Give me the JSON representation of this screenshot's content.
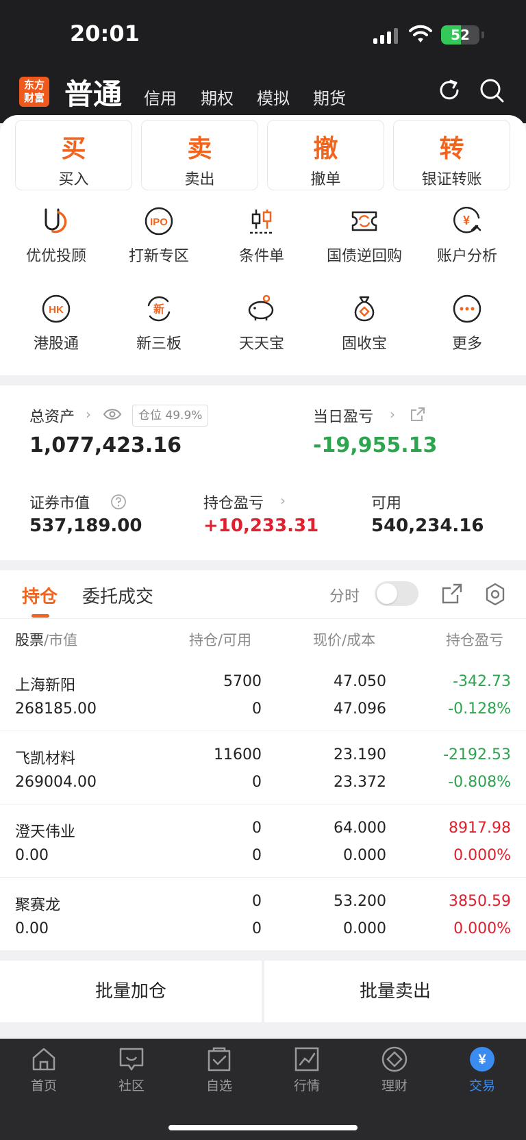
{
  "status": {
    "time": "20:01",
    "battery": "52",
    "battery_level": 0.52
  },
  "header": {
    "logo": [
      "东方",
      "财富"
    ],
    "active_tab": "普通",
    "tabs": [
      "信用",
      "期权",
      "模拟",
      "期货"
    ],
    "refresh_icon": "refresh-icon",
    "search_icon": "search-icon"
  },
  "trade_buttons": [
    {
      "big": "买",
      "small": "买入"
    },
    {
      "big": "卖",
      "small": "卖出"
    },
    {
      "big": "撤",
      "small": "撤单"
    },
    {
      "big": "转",
      "small": "银证转账"
    }
  ],
  "grid": [
    {
      "label": "优优投顾",
      "icon": "uu-advisor-icon"
    },
    {
      "label": "打新专区",
      "icon": "ipo-icon",
      "icon_text": "IPO"
    },
    {
      "label": "条件单",
      "icon": "candlestick-icon"
    },
    {
      "label": "国债逆回购",
      "icon": "repo-icon"
    },
    {
      "label": "账户分析",
      "icon": "yuan-analysis-icon",
      "icon_text": "¥"
    },
    {
      "label": "港股通",
      "icon": "hk-icon",
      "icon_text": "HK"
    },
    {
      "label": "新三板",
      "icon": "new-board-icon",
      "icon_text": "新"
    },
    {
      "label": "天天宝",
      "icon": "piggy-bank-icon"
    },
    {
      "label": "固收宝",
      "icon": "money-bag-icon"
    },
    {
      "label": "更多",
      "icon": "more-icon"
    }
  ],
  "assets": {
    "total_label": "总资产",
    "position_ratio": "仓位",
    "position_ratio_value": "49.9%",
    "total_value": "1,077,423.16",
    "daily_pl_label": "当日盈亏",
    "daily_pl_value": "-19,955.13",
    "market_value_label": "证券市值",
    "market_value": "537,189.00",
    "holding_pl_label": "持仓盈亏",
    "holding_pl_value": "+10,233.31",
    "available_label": "可用",
    "available_value": "540,234.16",
    "colors": {
      "negative": "#2da44e",
      "positive": "#e0202f",
      "accent": "#f0641e"
    }
  },
  "positions": {
    "tab_active": "持仓",
    "tab_other": "委托成交",
    "fenshi_label": "分时",
    "fenshi_on": false,
    "headers": {
      "c1a": "股票",
      "c1b": "/市值",
      "c2a": "持仓",
      "c2b": "/可用",
      "c3a": "现价",
      "c3b": "/成本",
      "c4": "持仓盈亏"
    },
    "rows": [
      {
        "name": "上海新阳",
        "market_value": "268185.00",
        "holding": "5700",
        "available": "0",
        "price": "47.050",
        "cost": "47.096",
        "pl": "-342.73",
        "pl_pct": "-0.128%",
        "trend": "neg"
      },
      {
        "name": "飞凯材料",
        "market_value": "269004.00",
        "holding": "11600",
        "available": "0",
        "price": "23.190",
        "cost": "23.372",
        "pl": "-2192.53",
        "pl_pct": "-0.808%",
        "trend": "neg"
      },
      {
        "name": "澄天伟业",
        "market_value": "0.00",
        "holding": "0",
        "available": "0",
        "price": "64.000",
        "cost": "0.000",
        "pl": "8917.98",
        "pl_pct": "0.000%",
        "trend": "pos"
      },
      {
        "name": "聚赛龙",
        "market_value": "0.00",
        "holding": "0",
        "available": "0",
        "price": "53.200",
        "cost": "0.000",
        "pl": "3850.59",
        "pl_pct": "0.000%",
        "trend": "pos"
      }
    ]
  },
  "batch": {
    "add": "批量加仓",
    "sell": "批量卖出"
  },
  "nav": [
    {
      "label": "首页",
      "icon": "home-icon"
    },
    {
      "label": "社区",
      "icon": "community-icon"
    },
    {
      "label": "自选",
      "icon": "watchlist-icon"
    },
    {
      "label": "行情",
      "icon": "market-icon"
    },
    {
      "label": "理财",
      "icon": "wealth-icon"
    },
    {
      "label": "交易",
      "icon": "trade-yuan-icon",
      "icon_text": "¥",
      "active": true
    }
  ]
}
